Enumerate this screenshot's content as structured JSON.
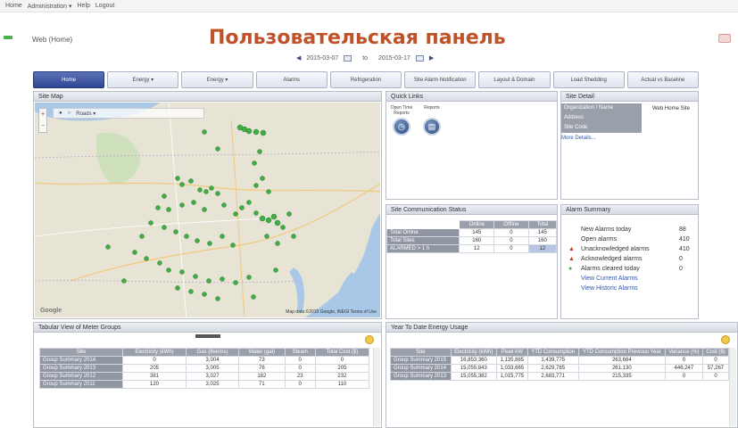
{
  "menubar": {
    "items": [
      "Home",
      "Administration ▾",
      "Help",
      "Logout"
    ]
  },
  "header": {
    "breadcrumb": "Web (Home)",
    "title": "Пользовательская панель",
    "date_from": "2015-03-07",
    "date_to_label": "to",
    "date_to": "2015-03-17"
  },
  "tabs": [
    {
      "label": "Home",
      "active": true
    },
    {
      "label": "Energy ▾"
    },
    {
      "label": "Energy ▾"
    },
    {
      "label": "Alarms"
    },
    {
      "label": "Refrigeration"
    },
    {
      "label": "Site Alarm Notification"
    },
    {
      "label": "Layout & Domain"
    },
    {
      "label": "Load Shedding"
    },
    {
      "label": "Actual vs Baseline"
    }
  ],
  "site_map": {
    "title": "Site Map",
    "toolbar_label": "Roads ▾",
    "google_label": "Google",
    "credit": "Map data ©2015 Google, INEGI   Terms of Use",
    "colors": {
      "water": "#a9c7e6",
      "land": "#e7e4d6",
      "pin": "#3fae45"
    }
  },
  "quick_links": {
    "title": "Quick Links",
    "items": [
      {
        "label": "Open Time Reports",
        "icon": "clock-icon"
      },
      {
        "label": "Reports",
        "icon": "report-icon"
      }
    ]
  },
  "site_detail": {
    "title": "Site Detail",
    "rows": [
      {
        "label": "Organization / Name",
        "value": "Web Home Site"
      },
      {
        "label": "Address",
        "value": ""
      },
      {
        "label": "Site Code",
        "value": ""
      }
    ],
    "more_link": "More Details..."
  },
  "site_comm": {
    "title": "Site Communication Status",
    "headers": [
      "",
      "Online",
      "Offline",
      "Total"
    ],
    "rows": [
      [
        "Total Online",
        "145",
        "0",
        "145"
      ],
      [
        "Total Sites",
        "160",
        "0",
        "160"
      ],
      [
        "ALARMED > 1 h",
        "12",
        "0",
        "12"
      ]
    ]
  },
  "alarm_summary": {
    "title": "Alarm Summary",
    "rows": [
      {
        "label": "New Alarms today",
        "value": "88",
        "icon": ""
      },
      {
        "label": "Open alarms",
        "value": "410",
        "icon": ""
      },
      {
        "label": "Unacknowledged alarms",
        "value": "410",
        "icon": "warning-icon"
      },
      {
        "label": "Acknowledged alarms",
        "value": "0",
        "icon": "warning-icon"
      },
      {
        "label": "Alarms cleared today",
        "value": "0",
        "icon": "check-icon"
      }
    ],
    "links": [
      "View Current Alarms",
      "View Historic Alarms"
    ]
  },
  "meter_groups": {
    "title": "Tabular View of Meter Groups",
    "headers": [
      "Site",
      "Electricity (kWh)",
      "Gas (therms)",
      "Water (gal)",
      "Steam",
      "Total Cost ($)"
    ],
    "rows": [
      [
        "Group Summary 2014",
        "0",
        "3,004",
        "73",
        "0",
        "0"
      ],
      [
        "Group Summary 2013",
        "205",
        "3,005",
        "76",
        "0",
        "205"
      ],
      [
        "Group Summary 2012",
        "381",
        "3,027",
        "182",
        "23",
        "232"
      ],
      [
        "Group Summary 2011",
        "120",
        "3,025",
        "71",
        "0",
        "110"
      ]
    ]
  },
  "ytd_energy": {
    "title": "Year To Date Energy Usage",
    "headers": [
      "Site",
      "Electricity (kWh)",
      "Peak kW",
      "YTD Consumption",
      "YTD Consumption Previous Year",
      "Variance (%)",
      "Cost ($)"
    ],
    "rows": [
      [
        "Group Summary 2015",
        "16,853,360",
        "1,135,865",
        "1,439,775",
        "263,664",
        "0",
        "0"
      ],
      [
        "Group Summary 2014",
        "15,055,843",
        "1,033,665",
        "2,629,785",
        "261,130",
        "446,247",
        "57,267"
      ],
      [
        "Group Summary 2013",
        "15,055,382",
        "1,015,775",
        "2,683,771",
        "215,335",
        "0",
        "0"
      ]
    ]
  }
}
